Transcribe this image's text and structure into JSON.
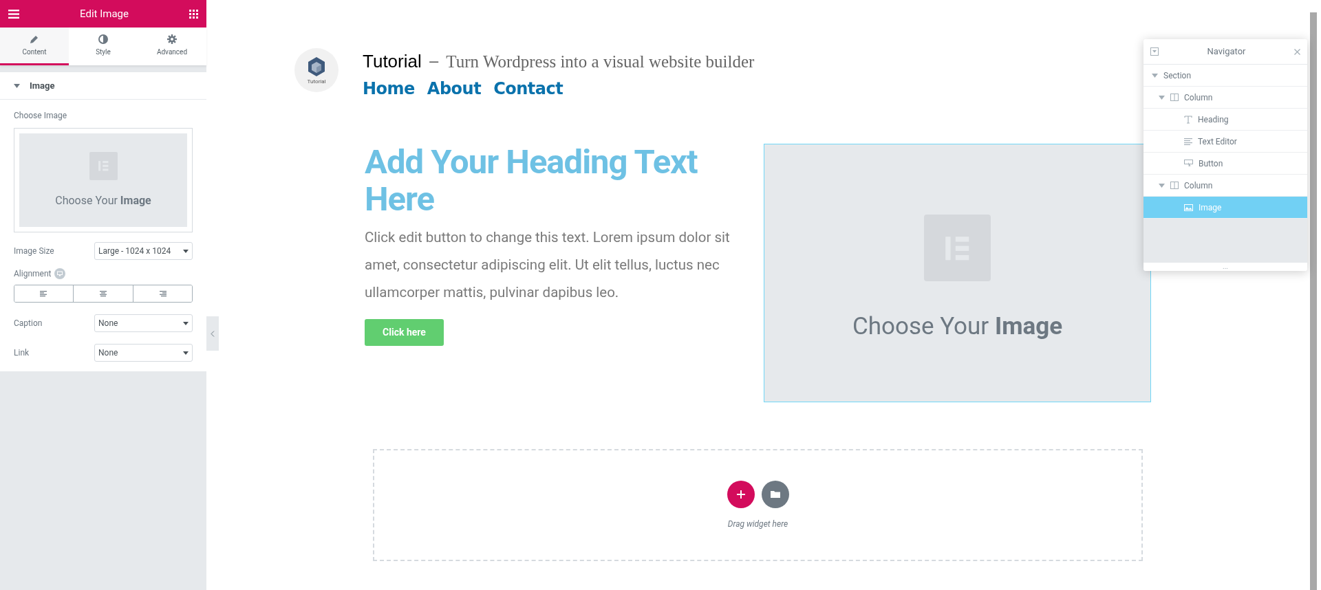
{
  "panel": {
    "title": "Edit Image",
    "tabs": [
      {
        "label": "Content",
        "kind": "pencil",
        "selected": true
      },
      {
        "label": "Style",
        "kind": "contrast",
        "selected": false
      },
      {
        "label": "Advanced",
        "kind": "gear",
        "selected": false
      }
    ],
    "section": {
      "title": "Image",
      "expanded": true
    },
    "choose_image": {
      "label": "Choose Image",
      "placeholder_text": "Choose Your **Image**"
    },
    "fields": [
      {
        "label": "Image Size",
        "value": "Large - 1024 x 1024"
      },
      {
        "kind": "alignment",
        "label": "Alignment",
        "options": [
          {
            "kind": "left",
            "selected": false
          },
          {
            "kind": "center",
            "selected": false
          },
          {
            "kind": "right",
            "selected": false
          }
        ]
      },
      {
        "label": "Caption",
        "value": "None"
      },
      {
        "label": "Link",
        "value": "None"
      }
    ]
  },
  "site": {
    "logo_text": "Tutorial",
    "name": "Tutorial",
    "separator": "—",
    "tagline": "Turn Wordpress into a visual website builder",
    "menu": [
      "Home",
      "About",
      "Contact"
    ]
  },
  "content": {
    "heading": "Add Your Heading Text Here",
    "text": "Click edit button to change this text. Lorem ipsum dolor sit amet, consectetur adipiscing elit. Ut elit tellus, luctus nec ullamcorper mattis, pulvinar dapibus leo.",
    "button": "Click here",
    "image_placeholder": "Choose Your **Image**"
  },
  "dropzone": {
    "hint": "Drag widget here"
  },
  "navigator": {
    "title": "Navigator",
    "footer": "...",
    "items": [
      {
        "label": "Section",
        "expanded": true,
        "selected": false,
        "children": [
          {
            "kind": "column",
            "label": "Column",
            "expanded": true,
            "selected": false,
            "children": [
              {
                "kind": "heading",
                "label": "Heading",
                "selected": false
              },
              {
                "kind": "text-editor",
                "label": "Text Editor",
                "selected": false
              },
              {
                "kind": "button",
                "label": "Button",
                "selected": false
              }
            ]
          },
          {
            "kind": "column",
            "label": "Column",
            "expanded": true,
            "selected": false,
            "children": [
              {
                "kind": "image",
                "label": "Image",
                "selected": true
              }
            ]
          }
        ]
      }
    ]
  }
}
